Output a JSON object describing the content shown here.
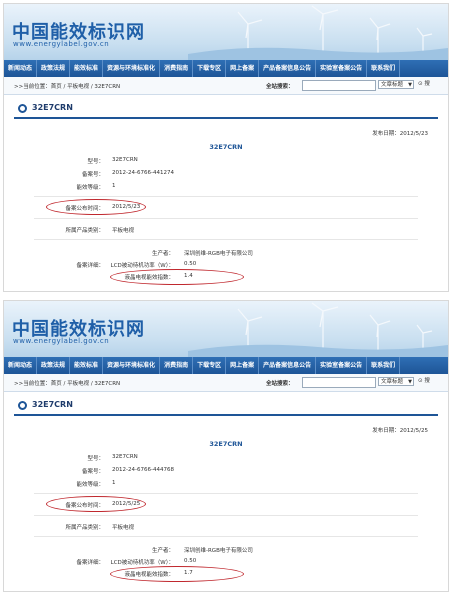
{
  "site": {
    "logo_text": "中国能效标识网",
    "logo_url": "www.energylabel.gov.cn"
  },
  "nav": [
    "新闻动态",
    "政策法规",
    "能效标准",
    "资源与环境标准化",
    "消费指南",
    "下载专区",
    "网上备案",
    "产品备案信息公告",
    "实验室备案公告",
    "联系我们"
  ],
  "crumb": ">>当前位置：首页 / 平板电视 / 32E7CRN",
  "search": {
    "label": "全站搜索：",
    "input_value": "",
    "select_value": "文章标题",
    "button_label": "搜"
  },
  "panels": [
    {
      "title": "32E7CRN",
      "pub_date": "发布日期：2012/5/23",
      "center_title": "32E7CRN",
      "fields": {
        "model_label": "型号：",
        "model_value": "32E7CRN",
        "filing_no_label": "备案号：",
        "filing_no_value": "2012-24-6766-441274",
        "grade_label": "能效等级：",
        "grade_value": "1",
        "announce_label": "备案公布时间：",
        "announce_value": "2012/5/23",
        "category_label": "所属产品类别：",
        "category_value": "平板电视",
        "detail_label": "备案详细：",
        "producer_label": "生产者：",
        "producer_value": "深圳创维-RGB电子有限公司",
        "standby_label": "LCD被动待机功率（W）：",
        "standby_value": "0.50",
        "efficiency_label": "液晶电视能效指数：",
        "efficiency_value": "1.4"
      }
    },
    {
      "title": "32E7CRN",
      "pub_date": "发布日期：2012/5/25",
      "center_title": "32E7CRN",
      "fields": {
        "model_label": "型号：",
        "model_value": "32E7CRN",
        "filing_no_label": "备案号：",
        "filing_no_value": "2012-24-6766-444768",
        "grade_label": "能效等级：",
        "grade_value": "1",
        "announce_label": "备案公布时间：",
        "announce_value": "2012/5/25",
        "category_label": "所属产品类别：",
        "category_value": "平板电视",
        "detail_label": "备案详细：",
        "producer_label": "生产者：",
        "producer_value": "深圳创维-RGB电子有限公司",
        "standby_label": "LCD被动待机功率（W）：",
        "standby_value": "0.50",
        "efficiency_label": "液晶电视能效指数：",
        "efficiency_value": "1.7"
      }
    }
  ],
  "colors": {
    "brand_blue": "#1f5fa8",
    "nav_blue": "#1e5597",
    "highlight_red": "#c0282e"
  }
}
